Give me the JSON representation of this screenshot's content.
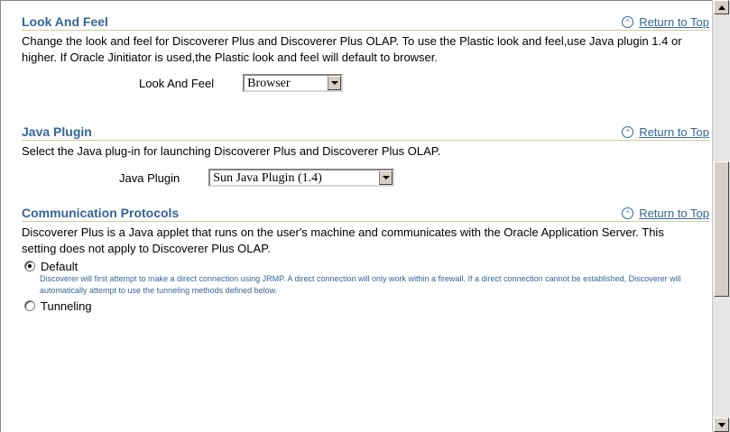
{
  "look_and_feel": {
    "title": "Look And Feel",
    "return_to_top": "Return to Top",
    "description": "Change the look and feel for Discoverer Plus and Discoverer Plus OLAP. To use the Plastic look and feel,use Java plugin 1.4 or higher. If Oracle Jinitiator is used,the Plastic look and feel will default to browser.",
    "field_label": "Look And Feel",
    "selected_value": "Browser"
  },
  "java_plugin": {
    "title": "Java Plugin",
    "return_to_top": "Return to Top",
    "description": "Select the Java plug-in for launching Discoverer Plus and Discoverer Plus OLAP.",
    "field_label": "Java Plugin",
    "selected_value": "Sun Java Plugin (1.4)"
  },
  "communication_protocols": {
    "title": "Communication Protocols",
    "return_to_top": "Return to Top",
    "description": "Discoverer Plus is a Java applet that runs on the user's machine and communicates with the Oracle Application Server. This setting does not apply to Discoverer Plus OLAP.",
    "options": [
      {
        "label": "Default",
        "selected": true,
        "hint": "Discoverer will first attempt to make a direct connection using JRMP. A direct connection will only work within a firewall. If a direct connection cannot be established, Discoverer will automatically attempt to use the tunneling methods defined below."
      },
      {
        "label": "Tunneling",
        "selected": false
      }
    ]
  },
  "colors": {
    "heading": "#336699",
    "rule": "#cccc99"
  }
}
